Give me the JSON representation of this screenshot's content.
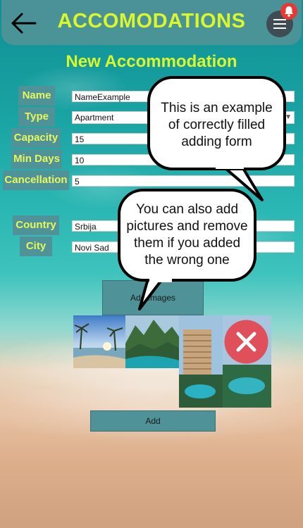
{
  "header": {
    "title": "ACCOMODATIONS",
    "back_icon": "arrow-left-icon",
    "menu_icon": "hamburger-menu-icon",
    "notification_icon": "bell-icon"
  },
  "page": {
    "subtitle": "New Accommodation"
  },
  "form": {
    "name_label": "Name",
    "name_value": "NameExample",
    "type_label": "Type",
    "type_value": "Apartment",
    "capacity_label": "Capacity",
    "capacity_value": "15",
    "min_days_label": "Min Days",
    "min_days_value": "10",
    "cancellation_label": "Cancellation",
    "cancellation_value": "5",
    "country_label": "Country",
    "country_value": "Srbija",
    "city_label": "City",
    "city_value": "Novi Sad"
  },
  "tooltips": {
    "example_form_line1": "This is an example",
    "example_form_line2": "of correctly filled",
    "example_form_line3": "adding form",
    "pictures_line1": "You can also add",
    "pictures_line2": "pictures and remove",
    "pictures_line3": "them if you added",
    "pictures_line4": "the wrong one"
  },
  "buttons": {
    "add_images": "Add Images",
    "add": "Add"
  },
  "images": {
    "remove_icon": "close-x-icon",
    "items": [
      "beach-palms-photo",
      "mountain-coast-photo",
      "resort-hotel-photo"
    ]
  },
  "colors": {
    "accent": "#d9f72b",
    "label_bg": "#4f9297",
    "remove": "#e0505a"
  }
}
